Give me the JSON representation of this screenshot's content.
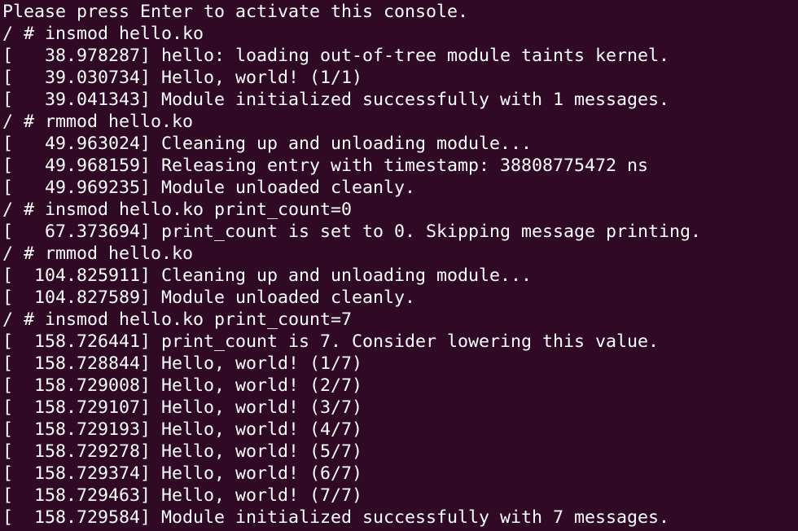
{
  "terminal": {
    "lines": [
      "Please press Enter to activate this console.",
      "/ # insmod hello.ko",
      "[   38.978287] hello: loading out-of-tree module taints kernel.",
      "[   39.030734] Hello, world! (1/1)",
      "[   39.041343] Module initialized successfully with 1 messages.",
      "/ # rmmod hello.ko",
      "[   49.963024] Cleaning up and unloading module...",
      "[   49.968159] Releasing entry with timestamp: 38808775472 ns",
      "[   49.969235] Module unloaded cleanly.",
      "/ # insmod hello.ko print_count=0",
      "[   67.373694] print_count is set to 0. Skipping message printing.",
      "/ # rmmod hello.ko",
      "[  104.825911] Cleaning up and unloading module...",
      "[  104.827589] Module unloaded cleanly.",
      "/ # insmod hello.ko print_count=7",
      "[  158.726441] print_count is 7. Consider lowering this value.",
      "[  158.728844] Hello, world! (1/7)",
      "[  158.729008] Hello, world! (2/7)",
      "[  158.729107] Hello, world! (3/7)",
      "[  158.729193] Hello, world! (4/7)",
      "[  158.729278] Hello, world! (5/7)",
      "[  158.729374] Hello, world! (6/7)",
      "[  158.729463] Hello, world! (7/7)",
      "[  158.729584] Module initialized successfully with 7 messages."
    ]
  },
  "colors": {
    "background": "#300a24",
    "foreground": "#ffffff"
  }
}
